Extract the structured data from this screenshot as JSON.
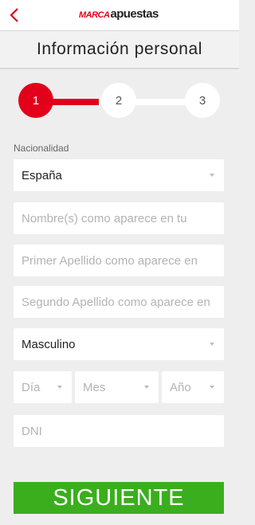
{
  "header": {
    "back_icon": "chevron-left-icon",
    "logo_marca": "MARCA",
    "logo_apuestas": "apuestas",
    "accent_color": "#e3001b"
  },
  "page": {
    "title": "Información personal"
  },
  "stepper": {
    "steps": [
      "1",
      "2",
      "3"
    ],
    "current_step": 1,
    "progress_color": "#e3001b"
  },
  "form": {
    "nationality": {
      "label": "Nacionalidad",
      "value": "España"
    },
    "first_name": {
      "placeholder": "Nombre(s) como aparece en tu"
    },
    "first_surname": {
      "placeholder": "Primer Apellido como aparece en"
    },
    "second_surname": {
      "placeholder": "Segundo Apellido como aparece en"
    },
    "gender": {
      "value": "Masculino"
    },
    "birth_day": {
      "placeholder": "Día"
    },
    "birth_month": {
      "placeholder": "Mes"
    },
    "birth_year": {
      "placeholder": "Año"
    },
    "dni": {
      "placeholder": "DNI"
    }
  },
  "submit": {
    "label": "SIGUIENTE",
    "color": "#3bae1e"
  }
}
